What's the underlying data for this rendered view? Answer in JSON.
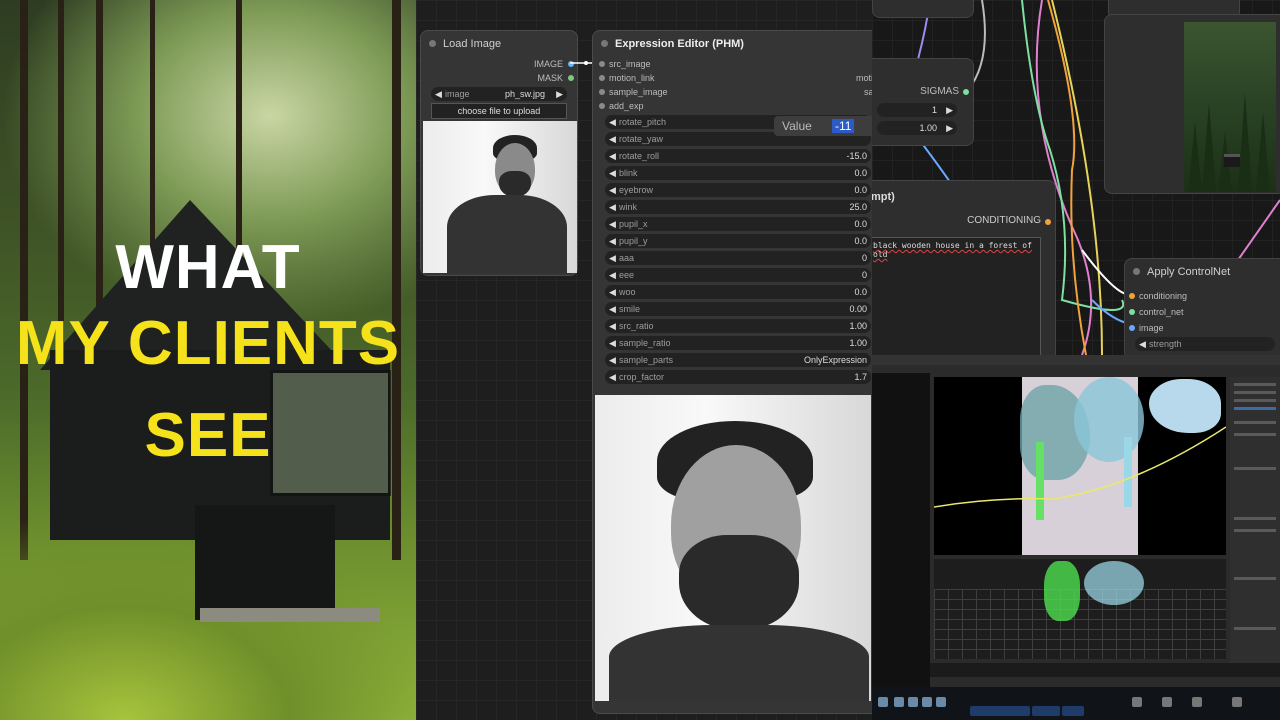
{
  "headline": {
    "line1": "WHAT",
    "line2": "MY CLIENTS",
    "line3": "SEE"
  },
  "load_image": {
    "title": "Load Image",
    "out_image": "IMAGE",
    "out_mask": "MASK",
    "image_label": "image",
    "image_value": "ph_sw.jpg",
    "upload_button": "choose file to upload"
  },
  "expression_editor": {
    "title": "Expression Editor (PHM)",
    "inputs": [
      {
        "label": "src_image",
        "right": "i"
      },
      {
        "label": "motion_link",
        "right": "motion"
      },
      {
        "label": "sample_image",
        "right": "save"
      },
      {
        "label": "add_exp",
        "right": ""
      }
    ],
    "params": [
      {
        "label": "rotate_pitch",
        "value": ""
      },
      {
        "label": "rotate_yaw",
        "value": ""
      },
      {
        "label": "rotate_roll",
        "value": "-15.0"
      },
      {
        "label": "blink",
        "value": "0.0"
      },
      {
        "label": "eyebrow",
        "value": "0.0"
      },
      {
        "label": "wink",
        "value": "25.0"
      },
      {
        "label": "pupil_x",
        "value": "0.0"
      },
      {
        "label": "pupil_y",
        "value": "0.0"
      },
      {
        "label": "aaa",
        "value": "0"
      },
      {
        "label": "eee",
        "value": "0"
      },
      {
        "label": "woo",
        "value": "0.0"
      },
      {
        "label": "smile",
        "value": "0.00"
      },
      {
        "label": "src_ratio",
        "value": "1.00"
      },
      {
        "label": "sample_ratio",
        "value": "1.00"
      },
      {
        "label": "sample_parts",
        "value": "OnlyExpression"
      },
      {
        "label": "crop_factor",
        "value": "1.7"
      }
    ]
  },
  "value_popup": {
    "label": "Value",
    "value": "-11"
  },
  "sigmas_node": {
    "output": "SIGMAS",
    "widget1_value": "1",
    "widget2_value": "1.00"
  },
  "prompt_node": {
    "title": "mpt)",
    "output": "CONDITIONING",
    "text": "black wooden house in a forest of old"
  },
  "controlnet_node": {
    "title": "Apply ControlNet",
    "inputs": [
      "conditioning",
      "control_net",
      "image"
    ],
    "widget": "strength"
  },
  "colors": {
    "accent_yellow": "#f6e21a",
    "node_bg": "#353535",
    "selection_blue": "#2c5bc8"
  }
}
